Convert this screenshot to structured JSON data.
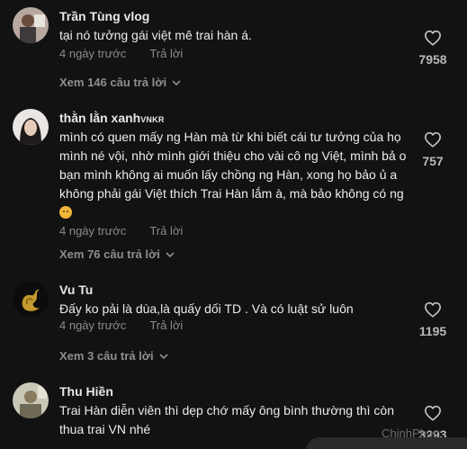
{
  "comments": [
    {
      "author": "Trần Tùng vlog",
      "author_suffix": "",
      "text": "tại nó tưởng gái việt mê trai hàn á.",
      "time": "4 ngày trước",
      "reply_label": "Trả lời",
      "likes": "7958",
      "view_replies": "Xem 146 câu trả lời"
    },
    {
      "author": "thằn lằn xanh",
      "author_suffix": "VNKR",
      "text": "mình có quen mấy ng Hàn mà từ khi biết cái tư tưởng của họ mình né vội, nhờ mình giới thiệu cho vài cô ng Việt, mình bả o bạn mình không ai muốn lấy chồng ng Hàn, xong họ bảo ủ a không phải gái Việt thích Trai Hàn lắm à, mà bảo không có ng",
      "time": "4 ngày trước",
      "reply_label": "Trả lời",
      "likes": "757",
      "view_replies": "Xem 76 câu trả lời"
    },
    {
      "author": "Vu Tu",
      "author_suffix": "",
      "text": "Đấy ko pải là dùa,là quấy dối TD . Và có luật sử luôn",
      "time": "4 ngày trước",
      "reply_label": "Trả lời",
      "likes": "1195",
      "view_replies": "Xem 3 câu trả lời"
    },
    {
      "author": "Thu Hiền",
      "author_suffix": "",
      "text": "Trai Hàn diễn viên thì dẹp chớ mấy ông bình thường thì còn thua trai VN nhé",
      "time": "",
      "reply_label": "",
      "likes": "3293",
      "view_replies": ""
    }
  ],
  "watermark": "ChinhPhuc",
  "icons": {
    "like": "heart-outline-icon",
    "expand": "chevron-down-icon",
    "emoji": "grimace-emoji-icon"
  },
  "colors": {
    "background": "#121212",
    "text_primary": "#ececec",
    "text_secondary": "#8a8a8a"
  }
}
